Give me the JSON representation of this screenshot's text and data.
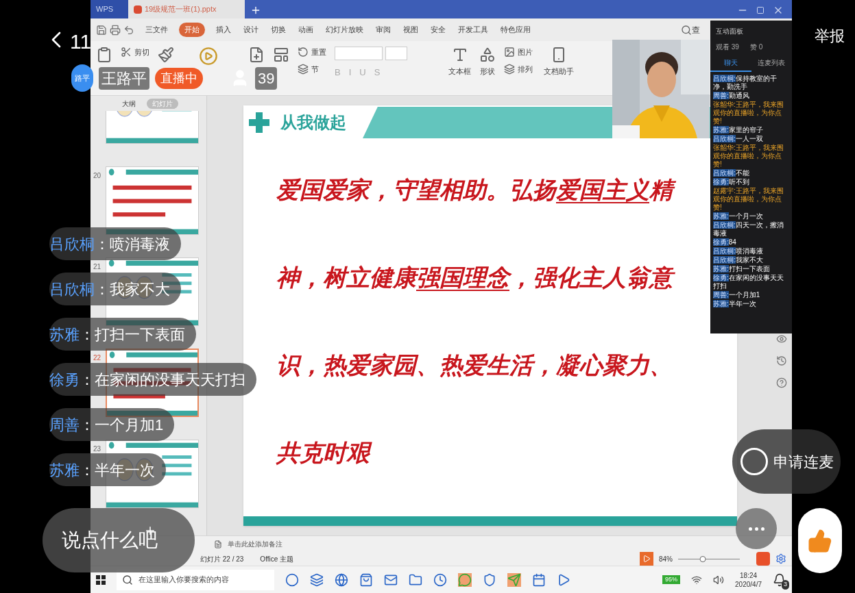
{
  "live": {
    "back_count": "11",
    "host": {
      "avatar_text": "路平",
      "name": "王路平",
      "status": "直播中",
      "viewers": "39"
    },
    "report": "举报",
    "comments": [
      {
        "name": "吕欣桐",
        "text": "：喷消毒液"
      },
      {
        "name": "吕欣桐",
        "text": "：我家不大"
      },
      {
        "name": "苏雅",
        "text": "：打扫一下表面"
      },
      {
        "name": "徐勇",
        "text": "：在家闲的没事天天打扫"
      },
      {
        "name": "周善",
        "text": "：一个月加1"
      },
      {
        "name": "苏雅",
        "text": "：半年一次"
      }
    ],
    "comment_input": {
      "placeholder": "说点什么吧"
    },
    "co_host_button": "申请连麦"
  },
  "screen": {
    "title_tabs": [
      {
        "label": "WPS",
        "selected": false
      },
      {
        "label": "19级规范一班(1).pptx",
        "selected": true
      }
    ],
    "menu": [
      {
        "label": "三文件",
        "selected": false
      },
      {
        "label": "开始",
        "selected": true
      },
      {
        "label": "插入",
        "selected": false
      },
      {
        "label": "设计",
        "selected": false
      },
      {
        "label": "切换",
        "selected": false
      },
      {
        "label": "动画",
        "selected": false
      },
      {
        "label": "幻灯片放映",
        "selected": false
      },
      {
        "label": "审阅",
        "selected": false
      },
      {
        "label": "视图",
        "selected": false
      },
      {
        "label": "安全",
        "selected": false
      },
      {
        "label": "开发工具",
        "selected": false
      },
      {
        "label": "特色应用",
        "selected": false
      }
    ],
    "find": "查",
    "toolbar": {
      "cut": "剪切",
      "reset": "重置",
      "section": "节",
      "format_buttons": [
        "B",
        "I",
        "U",
        "S"
      ],
      "textbox": "文本框",
      "shape": "形状",
      "picture": "图片",
      "arrange": "排列",
      "assistant": "文档助手"
    },
    "side_tabs": [
      {
        "label": "大纲",
        "selected": false
      },
      {
        "label": "幻灯片",
        "selected": true
      }
    ],
    "thumbnails": [
      {
        "selected": false
      },
      {
        "number": "20",
        "selected": false
      },
      {
        "number": "21",
        "selected": false
      },
      {
        "number": "22",
        "selected": true
      },
      {
        "number": "23",
        "selected": false
      }
    ],
    "slide": {
      "heading": "从我做起",
      "lines": [
        [
          {
            "text": "爱国爱家，守望相助。弘扬",
            "underline": false
          },
          {
            "text": "爱国主义",
            "underline": true
          },
          {
            "text": "精",
            "underline": false
          }
        ],
        [
          {
            "text": "神，树立健康",
            "underline": false
          },
          {
            "text": "强国理念",
            "underline": true
          },
          {
            "text": "，强化主人翁意",
            "underline": false
          }
        ],
        [
          {
            "text": "识，热爱家园、热爱生活，凝心聚力、",
            "underline": false
          }
        ],
        [
          {
            "text": "共克时艰",
            "underline": false
          }
        ]
      ]
    },
    "notes_placeholder": "单击此处添加备注",
    "status": {
      "slide_count": "幻灯片 22 / 23",
      "theme": "Office 主题",
      "zoom": "84%",
      "zoom_slider": {
        "level": 0.4
      }
    },
    "taskbar": {
      "search_placeholder": "在这里输入你要搜索的内容",
      "battery": "95%",
      "time": "18:24",
      "date": "2020/4/7",
      "notifications": "3"
    },
    "panel": {
      "title": "互动面板",
      "views": "观看 39",
      "likes": "赞 0",
      "tabs": [
        {
          "label": "聊天",
          "selected": true
        },
        {
          "label": "连麦列表",
          "selected": false
        }
      ],
      "messages": [
        {
          "kind": "chat",
          "name": "吕欣桐:",
          "text": "保持教室的干净，勤洗手"
        },
        {
          "kind": "chat",
          "name": "周善:",
          "text": "勤通风"
        },
        {
          "kind": "system",
          "name": "张韶华:",
          "text": "王路平，我来围观你的直播啦，为你点赞!"
        },
        {
          "kind": "chat",
          "name": "苏雅:",
          "text": "家里的帘子"
        },
        {
          "kind": "chat",
          "name": "吕欣桐:",
          "text": "一人一双"
        },
        {
          "kind": "system",
          "name": "张韶华:",
          "text": "王路平，我来围观你的直播啦，为你点赞!"
        },
        {
          "kind": "chat",
          "name": "吕欣桐:",
          "text": "不能"
        },
        {
          "kind": "chat",
          "name": "徐勇:",
          "text": "听不到"
        },
        {
          "kind": "system",
          "name": "赵露宇:",
          "text": "王路平，我来围观你的直播啦，为你点赞!"
        },
        {
          "kind": "chat",
          "name": "苏雅:",
          "text": "一个月一次"
        },
        {
          "kind": "chat",
          "name": "吕欣桐:",
          "text": "四天一次，擦消毒液"
        },
        {
          "kind": "chat",
          "name": "徐勇:",
          "text": "84"
        },
        {
          "kind": "chat",
          "name": "吕欣桐:",
          "text": "喷消毒液"
        },
        {
          "kind": "chat",
          "name": "吕欣桐:",
          "text": "我家不大"
        },
        {
          "kind": "chat",
          "name": "苏雅:",
          "text": "打扫一下表面"
        },
        {
          "kind": "chat",
          "name": "徐勇:",
          "text": "在家闲的没事天天打扫"
        },
        {
          "kind": "chat",
          "name": "周善:",
          "text": "一个月加1"
        },
        {
          "kind": "chat",
          "name": "苏雅:",
          "text": "半年一次"
        }
      ]
    }
  }
}
